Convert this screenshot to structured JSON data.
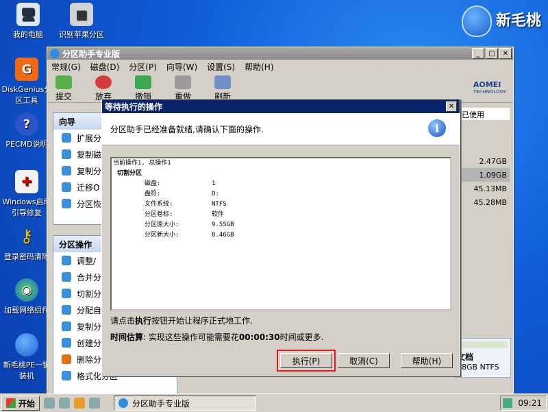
{
  "desktop": {
    "icons": [
      {
        "label": "我的电脑",
        "icon": "computer-icon"
      },
      {
        "label": "识别苹果分区",
        "icon": "apple-disk-icon"
      },
      {
        "label": "DiskGenius分区工具",
        "icon": "diskgenius-icon"
      },
      {
        "label": "PECMD说明",
        "icon": "help-icon"
      },
      {
        "label": "Windows启动引导修复",
        "icon": "repair-icon"
      },
      {
        "label": "登录密码清除",
        "icon": "key-icon"
      },
      {
        "label": "加载网络组件",
        "icon": "network-icon"
      },
      {
        "label": "新毛桃PE一键装机",
        "icon": "installer-icon"
      }
    ],
    "brand": "新毛桃"
  },
  "app": {
    "title": "分区助手专业版",
    "menu": [
      "常规(G)",
      "磁盘(D)",
      "分区(P)",
      "向导(W)",
      "设置(S)",
      "帮助(H)"
    ],
    "toolbar": [
      "提交",
      "放弃",
      "撤销",
      "重做",
      "刷新"
    ],
    "logo": "AOMEI",
    "logo_sub": "TECHNOLOGY",
    "wizard_panel": {
      "title": "向导",
      "items": [
        "扩展分",
        "复制磁",
        "复制分",
        "迁移O",
        "分区恢"
      ]
    },
    "partition_panel": {
      "title": "分区操作",
      "items": [
        "调整/",
        "合并分",
        "切割分",
        "分配自",
        "复制分",
        "创建分",
        "删除分",
        "格式化分区"
      ]
    },
    "right_column": {
      "header": "已使用",
      "values": [
        "2.47GB",
        "1.09GB",
        "45.13MB",
        "45.28MB"
      ],
      "disk_label": "文档",
      "disk_size": "98GB NTFS"
    }
  },
  "dialog": {
    "title": "等待执行的操作",
    "header": "分区助手已经准备就绪,请确认下面的操作.",
    "op_header": "当前操作1, 总操作1",
    "op_name": "切割分区",
    "details": [
      {
        "k": "磁盘:",
        "v": "1"
      },
      {
        "k": "盘符:",
        "v": "D:"
      },
      {
        "k": "文件系统:",
        "v": "NTFS"
      },
      {
        "k": "分区卷标:",
        "v": "软件"
      },
      {
        "k": "分区原大小:",
        "v": "9.55GB"
      },
      {
        "k": "分区新大小:",
        "v": "8.46GB"
      }
    ],
    "instruction_pre": "请点击",
    "instruction_bold": "执行",
    "instruction_post": "按钮开始让程序正式地工作.",
    "estimate_label": "时间估算",
    "estimate_pre": ": 实现这些操作可能需要花",
    "estimate_time": "00:00:30",
    "estimate_post": "时间或更多.",
    "buttons": {
      "execute": "执行(P)",
      "cancel": "取消(C)",
      "help": "帮助(H)"
    }
  },
  "taskbar": {
    "start": "开始",
    "task": "分区助手专业版",
    "clock": "09:21"
  }
}
